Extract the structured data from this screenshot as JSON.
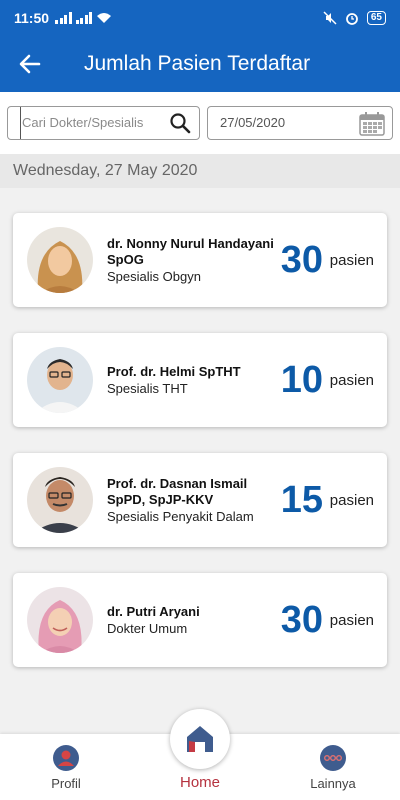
{
  "status_bar": {
    "time": "11:50",
    "battery": "65"
  },
  "app_bar": {
    "title": "Jumlah Pasien Terdaftar"
  },
  "search": {
    "placeholder": "Cari Dokter/Spesialis"
  },
  "date_field": {
    "value": "27/05/2020"
  },
  "date_header": "Wednesday, 27 May 2020",
  "doctors": [
    {
      "name": "dr. Nonny Nurul Handayani SpOG",
      "specialty": "Spesialis Obgyn",
      "count": "30",
      "unit": "pasien"
    },
    {
      "name": "Prof. dr. Helmi SpTHT",
      "specialty": "Spesialis THT",
      "count": "10",
      "unit": "pasien"
    },
    {
      "name": "Prof. dr. Dasnan Ismail SpPD, SpJP-KKV",
      "specialty": "Spesialis Penyakit Dalam",
      "count": "15",
      "unit": "pasien"
    },
    {
      "name": "dr. Putri Aryani",
      "specialty": "Dokter Umum",
      "count": "30",
      "unit": "pasien"
    }
  ],
  "bottom_nav": [
    {
      "label": "Profil",
      "icon": "profile-icon"
    },
    {
      "label": "Home",
      "icon": "home-icon"
    },
    {
      "label": "Lainnya",
      "icon": "more-icon"
    }
  ],
  "colors": {
    "primary": "#1565c0",
    "count": "#0d5aa7",
    "home_accent": "#b5323f"
  }
}
